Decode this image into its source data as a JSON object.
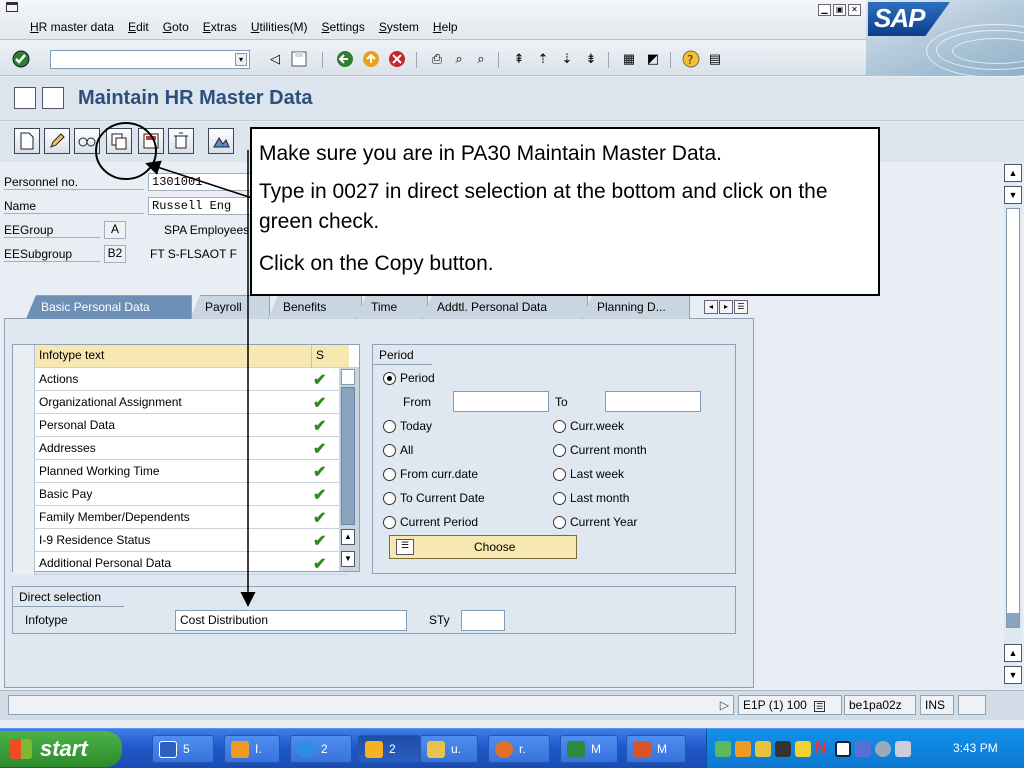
{
  "menubar": {
    "items": [
      "HR master data",
      "Edit",
      "Goto",
      "Extras",
      "Utilities(M)",
      "Settings",
      "System",
      "Help"
    ]
  },
  "logo": {
    "text": "SAP"
  },
  "screen": {
    "title": "Maintain HR Master Data"
  },
  "header": {
    "personnel_no": {
      "label": "Personnel no.",
      "value": "1301001"
    },
    "name": {
      "label": "Name",
      "value": "Russell Eng"
    },
    "eegroup": {
      "label": "EEGroup",
      "code": "A",
      "text": "SPA Employees"
    },
    "eesubgroup": {
      "label": "EESubgroup",
      "code": "B2",
      "text": "FT S-FLSAOT F"
    }
  },
  "tabs": [
    "Basic Personal Data",
    "Payroll",
    "Benefits",
    "Time",
    "Addtl. Personal Data",
    "Planning D..."
  ],
  "infotypes": {
    "header_text": "Infotype text",
    "header_s": "S",
    "rows": [
      "Actions",
      "Organizational Assignment",
      "Personal Data",
      "Addresses",
      "Planned Working Time",
      "Basic Pay",
      "Family Member/Dependents",
      "I-9 Residence Status",
      "Additional Personal Data"
    ],
    "check_glyph": "✔"
  },
  "period": {
    "group_label": "Period",
    "from_label": "From",
    "to_label": "To",
    "options": {
      "period": "Period",
      "today": "Today",
      "curr_week": "Curr.week",
      "all": "All",
      "current_month": "Current month",
      "from_curr_date": "From curr.date",
      "last_week": "Last week",
      "to_current_date": "To Current Date",
      "last_month": "Last month",
      "current_period": "Current Period",
      "current_year": "Current Year"
    },
    "selected": "period",
    "choose_label": "Choose"
  },
  "direct_selection": {
    "group_label": "Direct selection",
    "infotype_label": "Infotype",
    "infotype_value": "Cost Distribution",
    "sty_label": "STy",
    "sty_value": ""
  },
  "statusbar": {
    "system": "E1P (1) 100",
    "server": "be1pa02z",
    "mode": "INS"
  },
  "taskbar": {
    "start_label": "start",
    "tasks": [
      "5",
      "I.",
      "2",
      "2",
      "u.",
      "r.",
      "M",
      "M"
    ],
    "clock": "3:43 PM"
  },
  "callout": {
    "line1": "Make sure you are in PA30 Maintain Master Data.",
    "line2": "Type in 0027 in direct selection at the bottom and click on the green check.",
    "line3": "Click on the Copy button."
  },
  "colors": {
    "accent": "#2c4f7c",
    "check": "#2f8a1f",
    "highlight": "#f7e7b0"
  }
}
